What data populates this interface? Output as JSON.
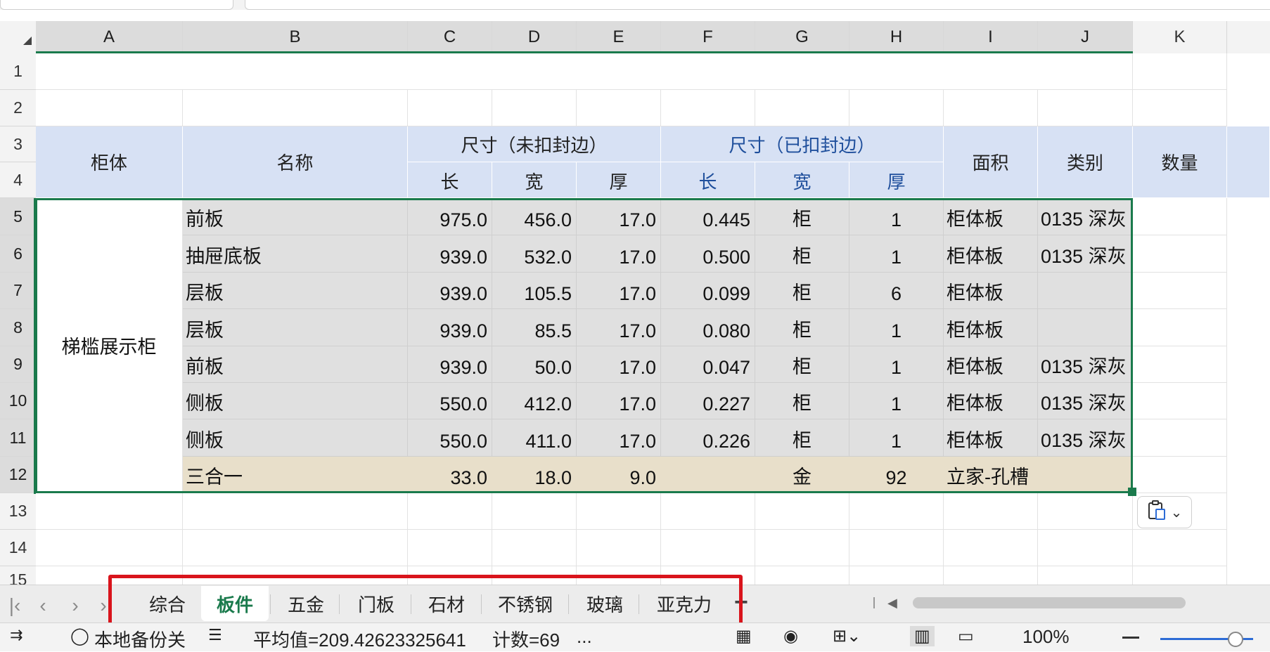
{
  "columns": [
    "A",
    "B",
    "C",
    "D",
    "E",
    "F",
    "G",
    "H",
    "I",
    "J",
    "K"
  ],
  "rows": [
    "1",
    "2",
    "3",
    "4",
    "5",
    "6",
    "7",
    "8",
    "9",
    "10",
    "11",
    "12",
    "13",
    "14",
    "15"
  ],
  "header": {
    "cabinet": "柜体",
    "name": "名称",
    "size_raw": "尺寸（未扣封边）",
    "size_edge": "尺寸（已扣封边）",
    "len": "长",
    "wid": "宽",
    "thk": "厚",
    "len2": "长",
    "wid2": "宽",
    "thk2": "厚",
    "area": "面积",
    "category": "类别",
    "qty": "数量"
  },
  "group_label": "梯槛展示柜",
  "data_rows": [
    {
      "name": "前板",
      "c": "975.0",
      "d": "456.0",
      "e": "17.0",
      "f": "0.445",
      "g": "柜",
      "h": "1",
      "i": "柜体板",
      "j": "0135 深灰"
    },
    {
      "name": "抽屉底板",
      "c": "939.0",
      "d": "532.0",
      "e": "17.0",
      "f": "0.500",
      "g": "柜",
      "h": "1",
      "i": "柜体板",
      "j": "0135 深灰"
    },
    {
      "name": "层板",
      "c": "939.0",
      "d": "105.5",
      "e": "17.0",
      "f": "0.099",
      "g": "柜",
      "h": "6",
      "i": "柜体板",
      "j": ""
    },
    {
      "name": "层板",
      "c": "939.0",
      "d": "85.5",
      "e": "17.0",
      "f": "0.080",
      "g": "柜",
      "h": "1",
      "i": "柜体板",
      "j": ""
    },
    {
      "name": "前板",
      "c": "939.0",
      "d": "50.0",
      "e": "17.0",
      "f": "0.047",
      "g": "柜",
      "h": "1",
      "i": "柜体板",
      "j": "0135 深灰"
    },
    {
      "name": "侧板",
      "c": "550.0",
      "d": "412.0",
      "e": "17.0",
      "f": "0.227",
      "g": "柜",
      "h": "1",
      "i": "柜体板",
      "j": "0135 深灰"
    },
    {
      "name": "侧板",
      "c": "550.0",
      "d": "411.0",
      "e": "17.0",
      "f": "0.226",
      "g": "柜",
      "h": "1",
      "i": "柜体板",
      "j": "0135 深灰"
    },
    {
      "name": "三合一",
      "c": "33.0",
      "d": "18.0",
      "e": "9.0",
      "f": "",
      "g": "金",
      "h": "92",
      "i": "立家-孔槽",
      "j": ""
    }
  ],
  "tabs": [
    "综合",
    "板件",
    "五金",
    "门板",
    "石材",
    "不锈钢",
    "玻璃",
    "亚克力"
  ],
  "active_tab": "板件",
  "status": {
    "backup": "本地备份关",
    "average": "平均值=209.42623325641",
    "count": "计数=69",
    "more": "...",
    "zoom": "100%"
  },
  "colors": {
    "accent": "#1a7a4c",
    "header_fill": "#d7e1f4",
    "highlight": "#d9141c"
  }
}
